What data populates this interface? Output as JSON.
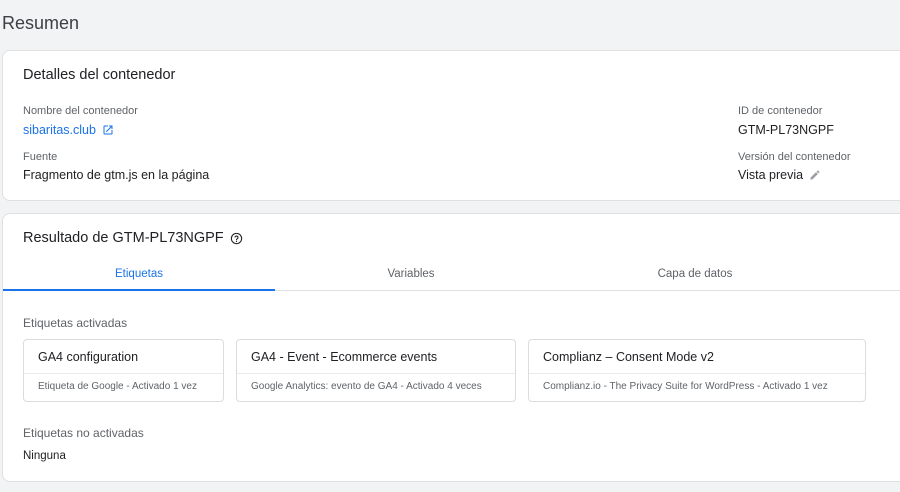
{
  "page": {
    "title": "Resumen"
  },
  "details": {
    "title": "Detalles del contenedor",
    "container_name_label": "Nombre del contenedor",
    "container_name_value": "sibaritas.club",
    "source_label": "Fuente",
    "source_value": "Fragmento de gtm.js en la página",
    "container_id_label": "ID de contenedor",
    "container_id_value": "GTM-PL73NGPF",
    "version_label": "Versión del contenedor",
    "version_value": "Vista previa"
  },
  "result": {
    "title": "Resultado de GTM-PL73NGPF",
    "tabs": [
      {
        "label": "Etiquetas",
        "active": true
      },
      {
        "label": "Variables",
        "active": false
      },
      {
        "label": "Capa de datos",
        "active": false
      }
    ],
    "fired_label": "Etiquetas activadas",
    "fired_tags": [
      {
        "name": "GA4 configuration",
        "meta": "Etiqueta de Google - Activado 1 vez"
      },
      {
        "name": "GA4 - Event - Ecommerce events",
        "meta": "Google Analytics: evento de GA4 - Activado 4 veces"
      },
      {
        "name": "Complianz – Consent Mode v2",
        "meta": "Complianz.io - The Privacy Suite for WordPress - Activado 1 vez"
      }
    ],
    "not_fired_label": "Etiquetas no activadas",
    "not_fired_value": "Ninguna"
  },
  "icons": {
    "external_link": "external-link-icon",
    "help": "help-icon",
    "edit": "pencil-icon"
  },
  "colors": {
    "accent": "#1a73e8",
    "background": "#f1f3f4"
  }
}
